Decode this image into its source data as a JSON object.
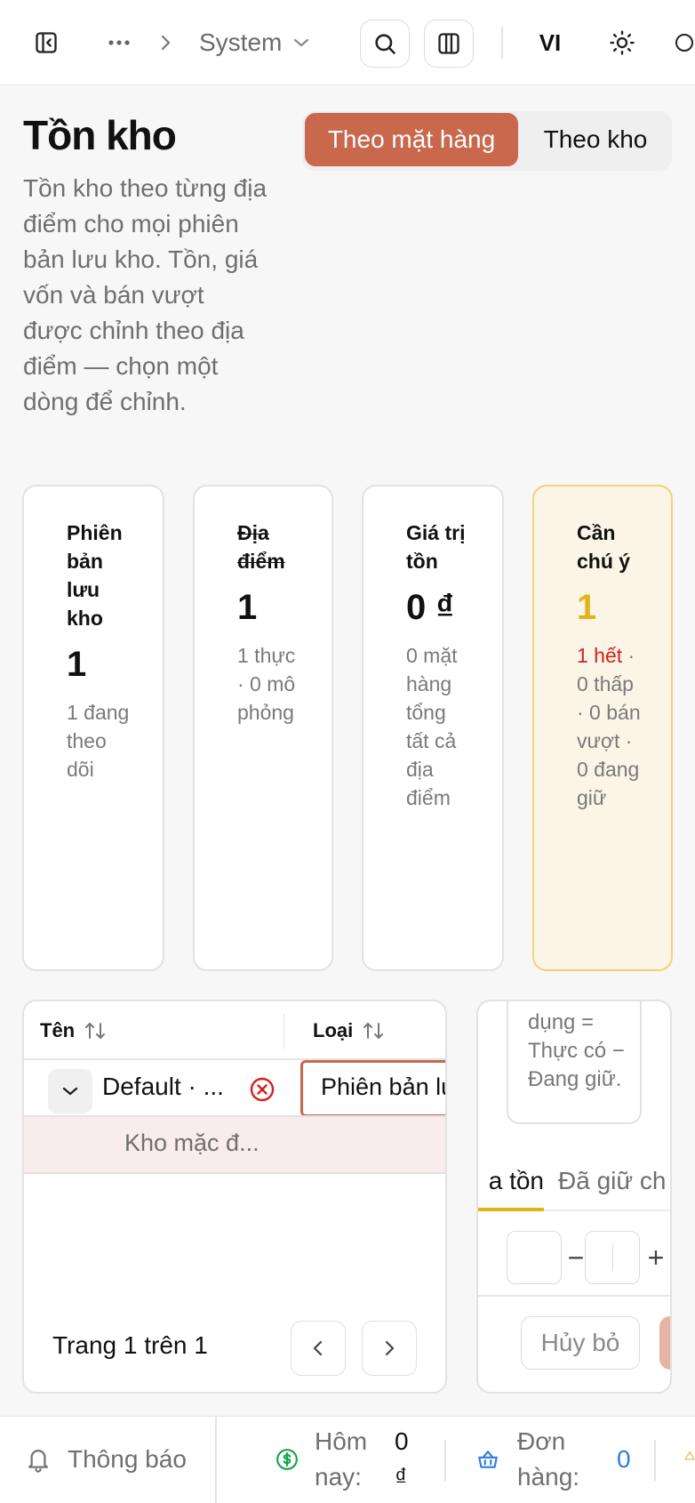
{
  "topbar": {
    "section": "System",
    "language": "VI",
    "icons": [
      "sidebar-toggle-icon",
      "ellipsis-icon",
      "chevron-right-icon",
      "chevron-down-icon",
      "search-icon",
      "columns-icon",
      "sun-icon",
      "moon-icon"
    ]
  },
  "header": {
    "title": "Tồn kho",
    "description": "Tồn kho theo từng địa điểm cho mọi phiên bản lưu kho. Tồn, giá vốn và bán vượt được chỉnh theo địa điểm — chọn một dòng để chỉnh.",
    "view_toggle": {
      "by_item": "Theo mặt hàng",
      "by_location": "Theo kho",
      "active": "by_item"
    }
  },
  "stats": {
    "variants": {
      "label": "Phiên bản lưu kho",
      "value": "1",
      "sub": "1 đang theo dõi"
    },
    "locations": {
      "label": "Địa điểm",
      "value": "1",
      "sub": "1 thực · 0 mô phỏng"
    },
    "stock_value": {
      "label": "Giá trị tồn",
      "value": "0 ₫",
      "sub": "0 mặt hàng tổng tất cả địa điểm"
    },
    "attention": {
      "label": "Cần chú ý",
      "value": "1",
      "sub_alert": "1 hết",
      "sub": "· 0 thấp · 0 bán vượt · 0 đang giữ"
    }
  },
  "table": {
    "columns": [
      "Tên",
      "Loại"
    ],
    "rows": [
      {
        "name": "Default · ...",
        "type": "Phiên bản lưu kho",
        "children": [
          "Kho mặc đ..."
        ]
      }
    ],
    "pagination": "Trang 1 trên 1"
  },
  "detail_panel": {
    "note": "dụng = Thực có − Đang giữ.",
    "tabs": [
      "a tồn",
      "Đã giữ ch"
    ],
    "stepper": {
      "minus": "−",
      "plus": "+"
    },
    "cancel_label": "Hủy bỏ"
  },
  "bottombar": {
    "notifications": "Thông báo",
    "today_label": "Hôm nay:",
    "today_value": "0 ₫",
    "orders_label": "Đơn hàng:",
    "orders_value": "0"
  },
  "colors": {
    "accent": "#c9684d",
    "warning_bg": "#faf5e6",
    "warning_border": "#efd27a",
    "gold": "#e2b31a",
    "danger": "#d42020",
    "link_blue": "#2f7de0",
    "money_green": "#16a34a"
  }
}
